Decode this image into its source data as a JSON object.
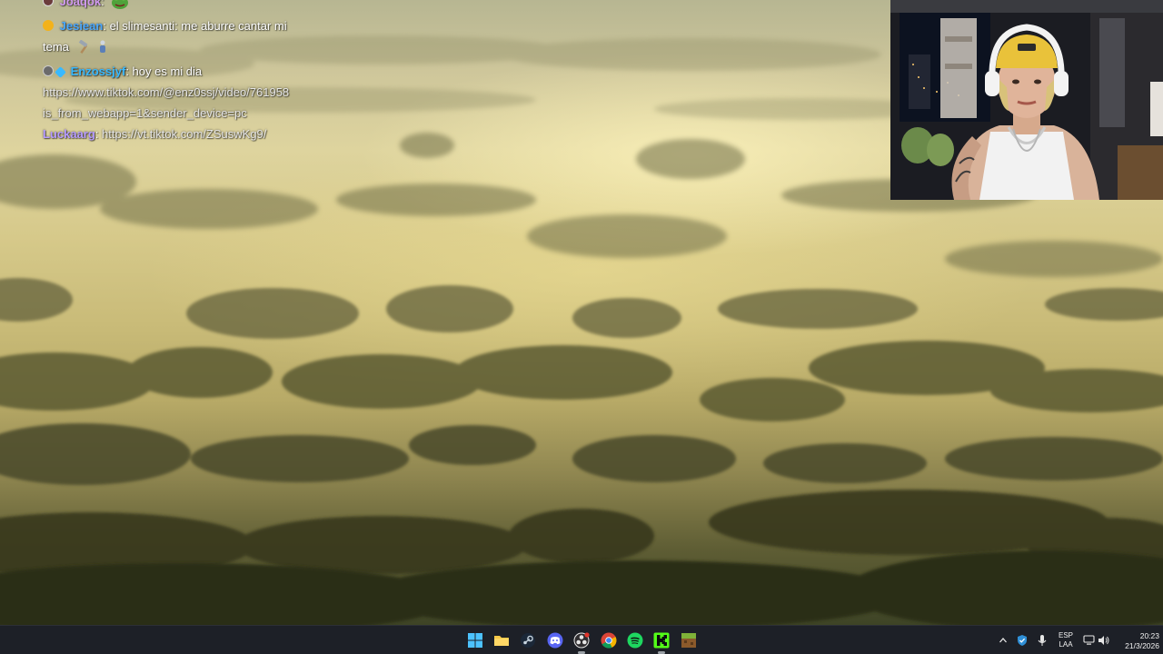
{
  "chat": {
    "messages": [
      {
        "user": "Joaqok",
        "user_color": "#d29bf0",
        "badges": [
          "mod-badge"
        ],
        "text": "",
        "emote": "frog-emote"
      },
      {
        "user": "Jesiean",
        "user_color": "#4aa8ff",
        "badges": [
          "coin-badge"
        ],
        "text": "el slimesanti: me aburre cantar mi",
        "continuation": "tema",
        "emote": "hammer-emote"
      },
      {
        "user": "Enzossjyf",
        "user_color": "#38b9ff",
        "badges": [
          "mod-badge",
          "gem-badge"
        ],
        "text": "hoy es mi dia",
        "link_lines": [
          "https://www.tiktok.com/@enz0ssj/video/761958",
          "is_from_webapp=1&sender_device=pc"
        ]
      },
      {
        "user": "Luckaarg",
        "user_color": "#b59bff",
        "badges": [],
        "text": "https://vt.tiktok.com/ZSuswKg9/"
      }
    ]
  },
  "taskbar": {
    "apps": [
      {
        "name": "start-button",
        "icon": "windows-icon",
        "color": "#4cc2ff"
      },
      {
        "name": "file-explorer",
        "icon": "folder-icon",
        "color": "#f7c948"
      },
      {
        "name": "steam",
        "icon": "steam-icon",
        "color": "#c7d5e0"
      },
      {
        "name": "discord",
        "icon": "discord-icon",
        "color": "#5865f2"
      },
      {
        "name": "obs",
        "icon": "obs-icon",
        "color": "#e6e6e6"
      },
      {
        "name": "chrome",
        "icon": "chrome-icon",
        "color": "#4285f4"
      },
      {
        "name": "spotify",
        "icon": "spotify-icon",
        "color": "#1ed760"
      },
      {
        "name": "kick",
        "icon": "kick-icon",
        "color": "#53fc18"
      },
      {
        "name": "minecraft",
        "icon": "minecraft-icon",
        "color": "#7fb238"
      }
    ],
    "tray": {
      "language_line1": "ESP",
      "language_line2": "LAA",
      "time": "20:23",
      "date": "21/3/2026"
    }
  }
}
